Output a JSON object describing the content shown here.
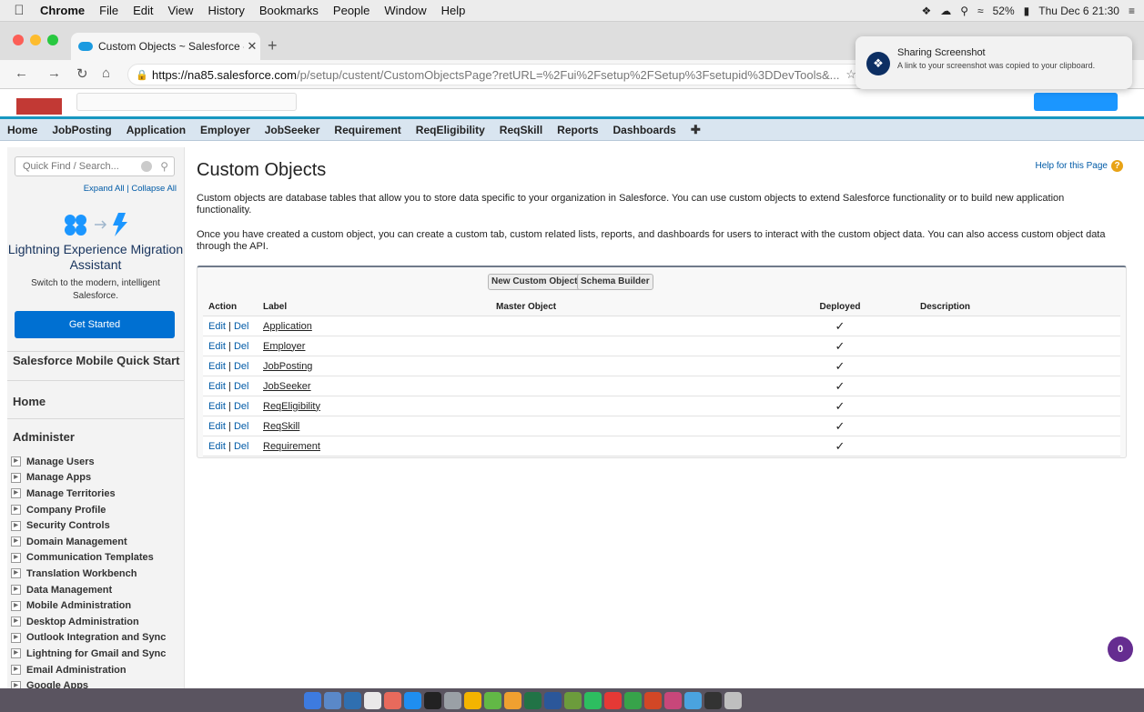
{
  "menubar": {
    "app": "Chrome",
    "items": [
      "File",
      "Edit",
      "View",
      "History",
      "Bookmarks",
      "People",
      "Window",
      "Help"
    ],
    "battery": "52%",
    "clock": "Thu Dec 6  21:30"
  },
  "browser": {
    "tab_title": "Custom Objects ~ Salesforce -",
    "url_host": "https://na85.salesforce.com",
    "url_path": "/p/setup/custent/CustomObjectsPage?retURL=%2Fui%2Fsetup%2FSetup%3Fsetupid%3DDevTools&..."
  },
  "notification": {
    "title": "Sharing Screenshot",
    "text": "A link to your screenshot was copied to your clipboard."
  },
  "navtabs": [
    "Home",
    "JobPosting",
    "Application",
    "Employer",
    "JobSeeker",
    "Requirement",
    "ReqEligibility",
    "ReqSkill",
    "Reports",
    "Dashboards"
  ],
  "sidebar": {
    "quickfind_placeholder": "Quick Find / Search...",
    "expand_collapse": "Expand All | Collapse All",
    "lex_title": "Lightning Experience Migration Assistant",
    "lex_sub": "Switch to the modern, intelligent Salesforce.",
    "get_started": "Get Started",
    "mobile_quick_start": "Salesforce Mobile Quick Start",
    "home": "Home",
    "administer": "Administer",
    "items": [
      "Manage Users",
      "Manage Apps",
      "Manage Territories",
      "Company Profile",
      "Security Controls",
      "Domain Management",
      "Communication Templates",
      "Translation Workbench",
      "Data Management",
      "Mobile Administration",
      "Desktop Administration",
      "Outlook Integration and Sync",
      "Lightning for Gmail and Sync",
      "Email Administration",
      "Google Apps"
    ]
  },
  "main": {
    "title": "Custom Objects",
    "help": "Help for this Page",
    "para1": "Custom objects are database tables that allow you to store data specific to your organization in Salesforce. You can use custom objects to extend Salesforce functionality or to build new application functionality.",
    "para2": "Once you have created a custom object, you can create a custom tab, custom related lists, reports, and dashboards for users to interact with the custom object data. You can also access custom object data through the API.",
    "btn_new": "New Custom Object",
    "btn_schema": "Schema Builder",
    "columns": [
      "Action",
      "Label",
      "Master Object",
      "Deployed",
      "Description"
    ],
    "rows": [
      {
        "edit": "Edit",
        "del": "Del",
        "label": "Application",
        "master": "",
        "deployed": "✓",
        "description": ""
      },
      {
        "edit": "Edit",
        "del": "Del",
        "label": "Employer",
        "master": "",
        "deployed": "✓",
        "description": ""
      },
      {
        "edit": "Edit",
        "del": "Del",
        "label": "JobPosting",
        "master": "",
        "deployed": "✓",
        "description": ""
      },
      {
        "edit": "Edit",
        "del": "Del",
        "label": "JobSeeker",
        "master": "",
        "deployed": "✓",
        "description": ""
      },
      {
        "edit": "Edit",
        "del": "Del",
        "label": "ReqEligibility",
        "master": "",
        "deployed": "✓",
        "description": ""
      },
      {
        "edit": "Edit",
        "del": "Del",
        "label": "ReqSkill",
        "master": "",
        "deployed": "✓",
        "description": ""
      },
      {
        "edit": "Edit",
        "del": "Del",
        "label": "Requirement",
        "master": "",
        "deployed": "✓",
        "description": ""
      }
    ]
  },
  "chat_bubble": "0",
  "colors": {
    "brand_blue": "#0070d2",
    "nav_accent": "#1797c0",
    "link": "#015ba7",
    "chat": "#652d90"
  }
}
